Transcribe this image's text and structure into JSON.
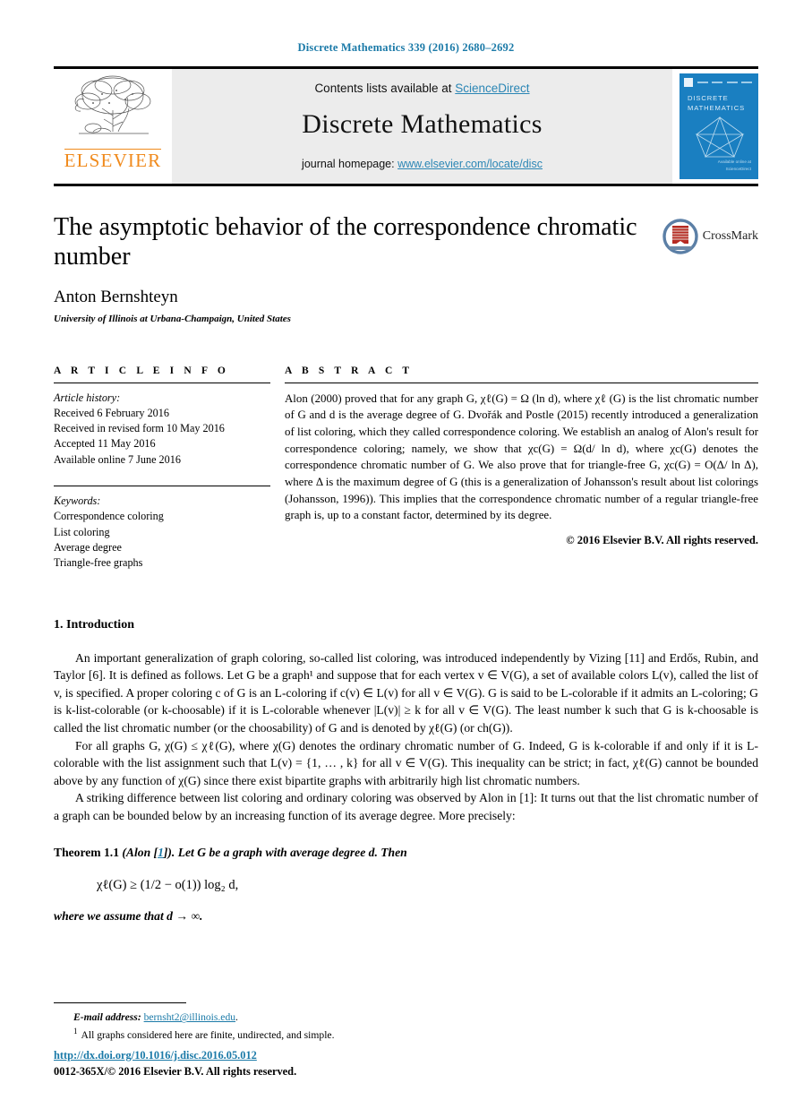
{
  "running_head": "Discrete Mathematics 339 (2016) 2680–2692",
  "masthead": {
    "contents_prefix": "Contents lists available at ",
    "contents_link": "ScienceDirect",
    "journal_name": "Discrete Mathematics",
    "homepage_prefix": "journal homepage: ",
    "homepage_link": "www.elsevier.com/locate/disc",
    "publisher_wordmark": "ELSEVIER",
    "cover_title_line1": "DISCRETE",
    "cover_title_line2": "MATHEMATICS",
    "cover_footer_line1": "Available online at",
    "cover_footer_line2": "ScienceDirect",
    "link_color": "#2b86b5",
    "band_color": "#ececec",
    "cover_color": "#1a7fc1",
    "elsevier_orange": "#f08a1c"
  },
  "title_block": {
    "title": "The asymptotic behavior of the correspondence chromatic number",
    "author": "Anton Bernshteyn",
    "affiliation": "University of Illinois at Urbana-Champaign, United States",
    "crossmark_label": "CrossMark"
  },
  "article_info": {
    "heading": "A R T I C L E  I N F O",
    "history_label": "Article history:",
    "history": [
      "Received 6 February 2016",
      "Received in revised form 10 May 2016",
      "Accepted 11 May 2016",
      "Available online 7 June 2016"
    ],
    "keywords_label": "Keywords:",
    "keywords": [
      "Correspondence coloring",
      "List coloring",
      "Average degree",
      "Triangle-free graphs"
    ]
  },
  "abstract": {
    "heading": "A B S T R A C T",
    "paragraph": "Alon (2000) proved that for any graph G, χℓ(G) = Ω (ln d), where χℓ (G) is the list chromatic number of G and d is the average degree of G. Dvořák and Postle (2015) recently introduced a generalization of list coloring, which they called correspondence coloring. We establish an analog of Alon's result for correspondence coloring; namely, we show that χc(G) = Ω(d/ ln d), where χc(G) denotes the correspondence chromatic number of G. We also prove that for triangle-free G, χc(G) = O(Δ/ ln Δ), where Δ is the maximum degree of G (this is a generalization of Johansson's result about list colorings (Johansson, 1996)). This implies that the correspondence chromatic number of a regular triangle-free graph is, up to a constant factor, determined by its degree.",
    "copyright": "© 2016 Elsevier B.V. All rights reserved."
  },
  "introduction": {
    "section_number": "1.",
    "section_title": "Introduction",
    "paragraph_1": "An important generalization of graph coloring, so-called list coloring, was introduced independently by Vizing [11] and Erdős, Rubin, and Taylor [6]. It is defined as follows. Let G be a graph¹ and suppose that for each vertex v ∈ V(G), a set of available colors L(v), called the list of v, is specified. A proper coloring c of G is an L-coloring if c(v) ∈ L(v) for all v ∈ V(G). G is said to be L-colorable if it admits an L-coloring; G is k-list-colorable (or k-choosable) if it is L-colorable whenever |L(v)| ≥ k for all v ∈ V(G). The least number k such that G is k-choosable is called the list chromatic number (or the choosability) of G and is denoted by χℓ(G) (or ch(G)).",
    "paragraph_2": "For all graphs G, χ(G) ≤ χℓ(G), where χ(G) denotes the ordinary chromatic number of G. Indeed, G is k-colorable if and only if it is L-colorable with the list assignment such that L(v) = {1, … , k} for all v ∈ V(G). This inequality can be strict; in fact, χℓ(G) cannot be bounded above by any function of χ(G) since there exist bipartite graphs with arbitrarily high list chromatic numbers.",
    "paragraph_3": "A striking difference between list coloring and ordinary coloring was observed by Alon in [1]: It turns out that the list chromatic number of a graph can be bounded below by an increasing function of its average degree. More precisely:",
    "citations": [
      "11",
      "6",
      "1"
    ]
  },
  "theorem": {
    "label": "Theorem 1.1",
    "attribution_prefix": "(Alon [",
    "attribution_ref": "1",
    "attribution_suffix": "]).",
    "statement": "Let G be a graph with average degree d. Then",
    "equation": "χℓ(G) ≥ (1/2 − o(1)) log₂ d,",
    "after_equation": "where we assume that d → ∞."
  },
  "footer": {
    "email_label": "E-mail address:",
    "email": "bernsht2@illinois.edu",
    "email_suffix": ".",
    "footnote_number": "1",
    "footnote_text": "All graphs considered here are finite, undirected, and simple.",
    "doi": "http://dx.doi.org/10.1016/j.disc.2016.05.012",
    "issn_line": "0012-365X/© 2016 Elsevier B.V. All rights reserved."
  }
}
